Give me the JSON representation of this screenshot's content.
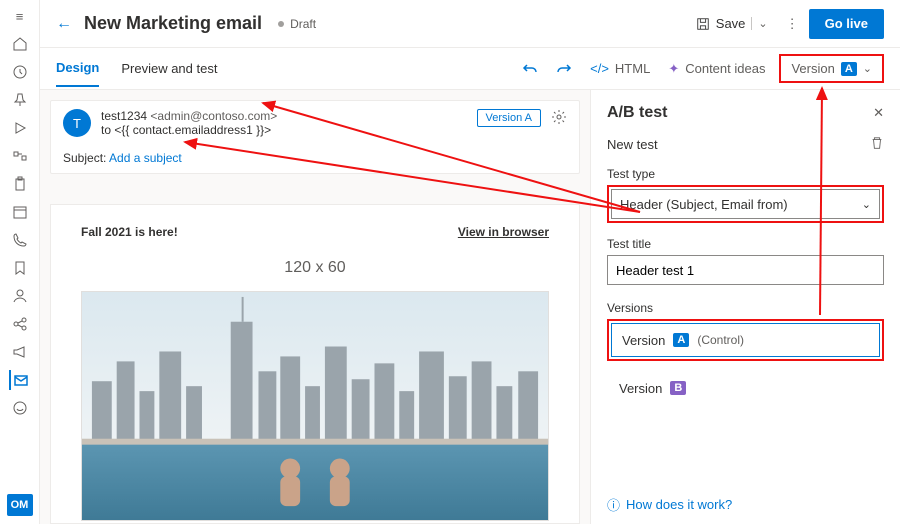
{
  "header": {
    "title": "New Marketing email",
    "status": "Draft",
    "save_label": "Save",
    "golive_label": "Go live"
  },
  "tabs": {
    "design": "Design",
    "preview": "Preview and test"
  },
  "tools": {
    "html": "HTML",
    "ideas": "Content ideas",
    "version_label": "Version",
    "version_badge": "A"
  },
  "email": {
    "avatar_initial": "T",
    "from_name": "test1234",
    "from_email": "<admin@contoso.com>",
    "to_label": "to",
    "to_value": "<{{ contact.emailaddress1 }}>",
    "version_pill": "Version A",
    "subject_label": "Subject:",
    "subject_placeholder": "Add a subject"
  },
  "body": {
    "headline": "Fall 2021 is here!",
    "view_browser": "View in browser",
    "logo_placeholder": "120 x 60"
  },
  "panel": {
    "title": "A/B test",
    "new_test": "New test",
    "test_type_label": "Test type",
    "test_type_value": "Header (Subject, Email from)",
    "test_title_label": "Test title",
    "test_title_value": "Header test 1",
    "versions_label": "Versions",
    "version_a_label": "Version",
    "version_a_badge": "A",
    "version_a_note": "(Control)",
    "version_b_label": "Version",
    "version_b_badge": "B",
    "help": "How does it work?"
  },
  "leftbar": {
    "om": "OM"
  }
}
